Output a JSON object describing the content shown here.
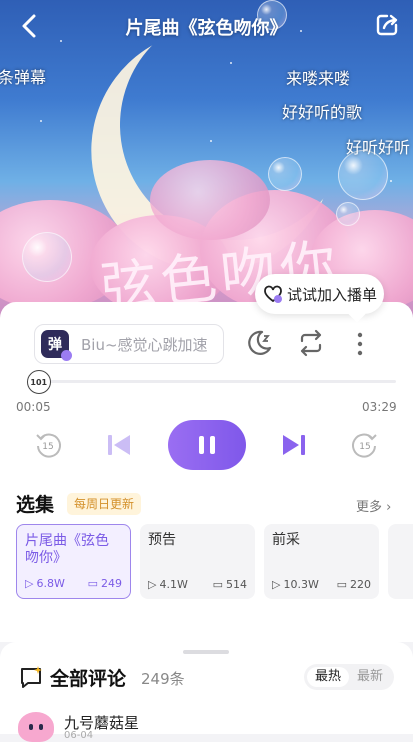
{
  "header": {
    "title": "片尾曲《弦色吻你》"
  },
  "artwork": {
    "calligraphy": "弦色吻你"
  },
  "danmaku": [
    {
      "text": "条弹幕"
    },
    {
      "text": "来喽来喽"
    },
    {
      "text": "好好听的歌"
    },
    {
      "text": "好听好听"
    }
  ],
  "tooltip": {
    "label": "试试加入播单"
  },
  "danmu_input": {
    "badge": "弹",
    "placeholder": "Biu~感觉心跳加速"
  },
  "player": {
    "current_time": "00:05",
    "total_time": "03:29",
    "progress_fraction": 0.024,
    "skip_back": "15",
    "skip_forward": "15",
    "knob_label": "101"
  },
  "episodes": {
    "title": "选集",
    "tag": "每周日更新",
    "more": "更多",
    "items": [
      {
        "name": "片尾曲《弦色吻你》",
        "plays": "6.8W",
        "comments": "249",
        "active": true
      },
      {
        "name": "预告",
        "plays": "4.1W",
        "comments": "514",
        "active": false
      },
      {
        "name": "前采",
        "plays": "10.3W",
        "comments": "220",
        "active": false
      }
    ]
  },
  "comments": {
    "title": "全部评论",
    "count": "249条",
    "sort_hot": "最热",
    "sort_new": "最新",
    "first_user": {
      "name": "九号蘑菇星",
      "meta": "06-04"
    }
  },
  "colors": {
    "accent": "#8a63ee",
    "tag_bg": "#fff4db",
    "tag_text": "#d4902a"
  }
}
